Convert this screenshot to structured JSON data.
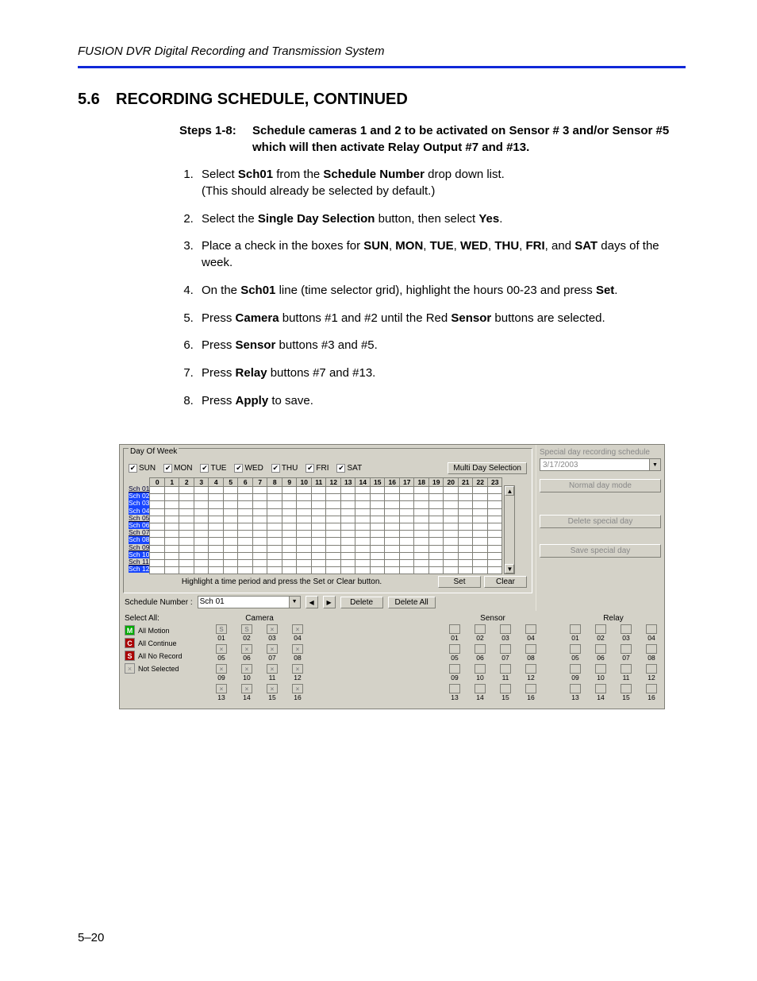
{
  "header": "FUSION DVR Digital Recording and Transmission System",
  "section": {
    "number": "5.6",
    "title": "RECORDING SCHEDULE, CONTINUED"
  },
  "steps_header": {
    "label": "Steps 1-8:",
    "text": "Schedule cameras 1 and 2 to be activated on Sensor # 3 and/or Sensor #5 which will then activate Relay Output #7 and #13."
  },
  "steps": [
    {
      "pre": "Select ",
      "b1": "Sch01",
      "mid1": " from the ",
      "b2": "Schedule Number",
      "post": " drop down list.",
      "tail": "(This should already be selected by default.)"
    },
    {
      "pre": "Select the ",
      "b1": "Single Day Selection",
      "mid1": " button, then select ",
      "b2": "Yes",
      "post": "."
    },
    {
      "pre": "Place a check in the boxes for ",
      "list": "SUN, MON, TUE, WED, THU, FRI, SAT",
      "post2": " days of the week."
    },
    {
      "pre": "On the ",
      "b1": "Sch01",
      "mid1": " line (time selector grid), highlight the hours 00-23 and press ",
      "b2": "Set",
      "post": "."
    },
    {
      "pre": "Press ",
      "b1": "Camera",
      "mid1": " buttons #1 and #2 until the Red ",
      "b2": "Sensor",
      "post": " buttons are selected."
    },
    {
      "pre": "Press ",
      "b1": "Sensor",
      "post": " buttons #3 and #5."
    },
    {
      "pre": "Press ",
      "b1": "Relay",
      "post": " buttons #7 and #13."
    },
    {
      "pre": "Press ",
      "b1": "Apply",
      "post": " to save."
    }
  ],
  "page_number": "5–20",
  "app": {
    "dow_label": "Day Of Week",
    "days": [
      "SUN",
      "MON",
      "TUE",
      "WED",
      "THU",
      "FRI",
      "SAT"
    ],
    "multi_btn": "Multi Day Selection",
    "hours": [
      "0",
      "1",
      "2",
      "3",
      "4",
      "5",
      "6",
      "7",
      "8",
      "9",
      "10",
      "11",
      "12",
      "13",
      "14",
      "15",
      "16",
      "17",
      "18",
      "19",
      "20",
      "21",
      "22",
      "23"
    ],
    "rows": [
      {
        "l": "Sch 01",
        "hi": false
      },
      {
        "l": "Sch 02",
        "hi": true
      },
      {
        "l": "Sch 03",
        "hi": true
      },
      {
        "l": "Sch 04",
        "hi": true
      },
      {
        "l": "Sch 05",
        "hi": false
      },
      {
        "l": "Sch 06",
        "hi": true
      },
      {
        "l": "Sch 07",
        "hi": false
      },
      {
        "l": "Sch 08",
        "hi": true
      },
      {
        "l": "Sch 09",
        "hi": false
      },
      {
        "l": "Sch 10",
        "hi": true
      },
      {
        "l": "Sch 11",
        "hi": false
      },
      {
        "l": "Sch 12",
        "hi": true
      }
    ],
    "hint": "Highlight a time period and press the Set or Clear button.",
    "set_btn": "Set",
    "clear_btn": "Clear",
    "sched_num_label": "Schedule Number :",
    "sched_val": "Sch 01",
    "delete_btn": "Delete",
    "delete_all_btn": "Delete All",
    "right": {
      "title": "Special day recording schedule",
      "date": "3/17/2003",
      "normal": "Normal day mode",
      "delete": "Delete special day",
      "save": "Save special day"
    },
    "selall_label": "Select All:",
    "selall": [
      {
        "sw": "M",
        "cls": "swM",
        "t": "All Motion"
      },
      {
        "sw": "C",
        "cls": "swC",
        "t": "All Continue"
      },
      {
        "sw": "S",
        "cls": "swS",
        "t": "All No Record"
      },
      {
        "sw": "×",
        "cls": "swX",
        "t": "Not Selected"
      }
    ],
    "camera": {
      "label": "Camera",
      "selected_red": [
        1,
        2
      ],
      "count": 16
    },
    "sensor": {
      "label": "Sensor",
      "selected_blue": [
        3,
        5
      ],
      "count": 16
    },
    "relay": {
      "label": "Relay",
      "selected_green": [
        7,
        13
      ],
      "count": 16
    }
  }
}
